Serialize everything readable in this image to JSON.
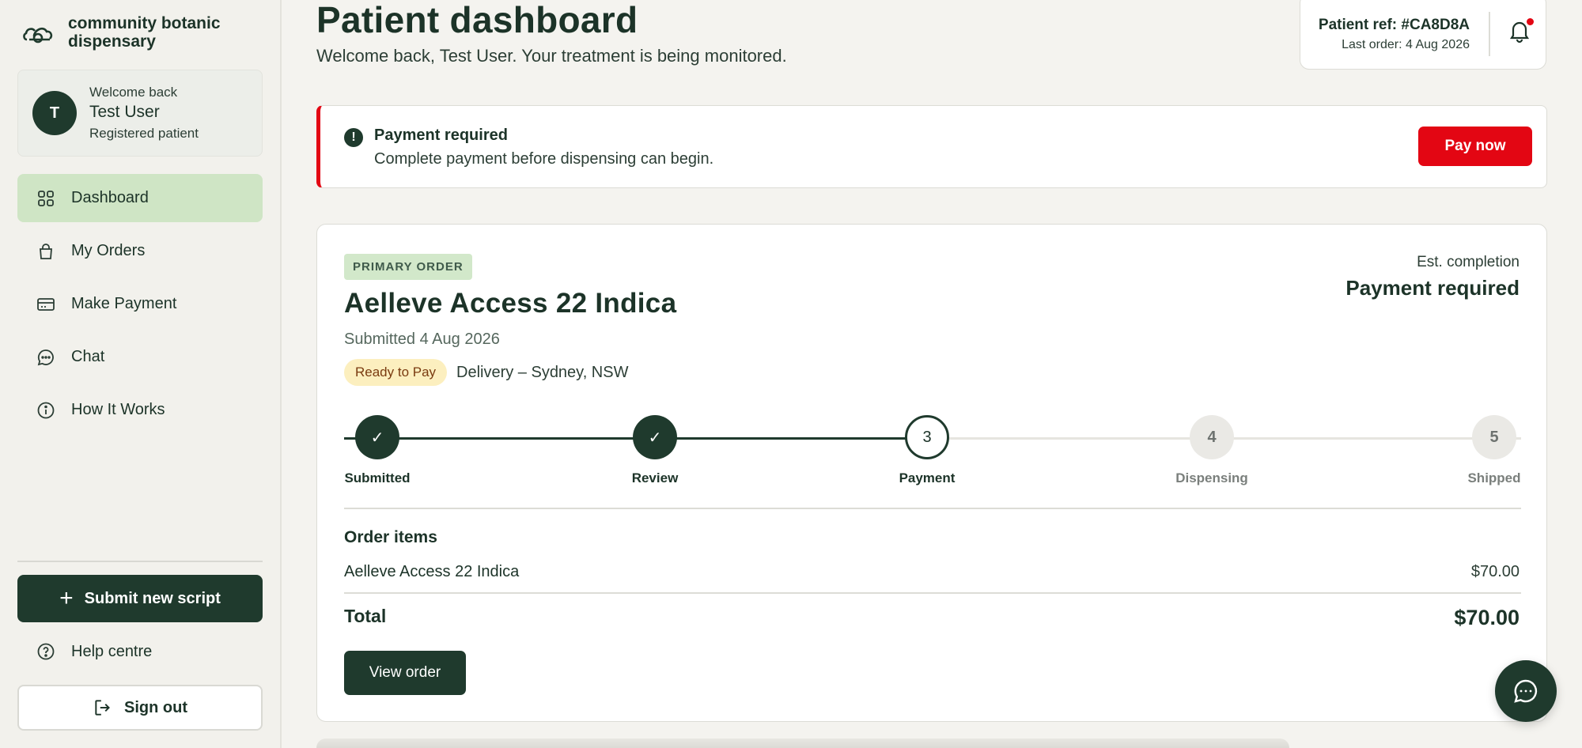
{
  "brand": {
    "name": "community botanic dispensary",
    "logo_icon": "cannabis-leaf-logo"
  },
  "user_card": {
    "avatar_initial": "T",
    "greeting": "Welcome back",
    "name": "Test User",
    "role": "Registered patient"
  },
  "sidebar": {
    "items": [
      {
        "label": "Dashboard",
        "icon": "grid-icon",
        "active": true
      },
      {
        "label": "My Orders",
        "icon": "bag-icon",
        "active": false
      },
      {
        "label": "Make Payment",
        "icon": "card-icon",
        "active": false
      },
      {
        "label": "Chat",
        "icon": "chat-bubble-icon",
        "active": false
      },
      {
        "label": "How It Works",
        "icon": "info-icon",
        "active": false
      }
    ],
    "submit_label": "Submit new script",
    "help_label": "Help centre",
    "signout_label": "Sign out"
  },
  "header": {
    "title": "Patient dashboard",
    "subtitle": "Welcome back, Test User. Your treatment is being monitored.",
    "patient_ref": "Patient ref: #CA8D8A",
    "last_order": "Last order: 4 Aug 2026",
    "notification_dot": true
  },
  "alert": {
    "title": "Payment required",
    "message": "Complete payment before dispensing can begin.",
    "button_label": "Pay now",
    "accent_color": "#e30613"
  },
  "order": {
    "badge": "PRIMARY ORDER",
    "name": "Aelleve Access 22 Indica",
    "submitted": "Submitted 4 Aug 2026",
    "status": "Ready to Pay",
    "delivery": "Delivery – Sydney, NSW",
    "est_label": "Est. completion",
    "est_value": "Payment required",
    "steps": [
      {
        "number": "1",
        "label": "Submitted",
        "state": "done"
      },
      {
        "number": "2",
        "label": "Review",
        "state": "done"
      },
      {
        "number": "3",
        "label": "Payment",
        "state": "current"
      },
      {
        "number": "4",
        "label": "Dispensing",
        "state": "todo"
      },
      {
        "number": "5",
        "label": "Shipped",
        "state": "todo"
      }
    ],
    "items_title": "Order items",
    "items": [
      {
        "name": "Aelleve Access 22 Indica",
        "price": "$70.00"
      }
    ],
    "total_label": "Total",
    "total_value": "$70.00",
    "view_label": "View order"
  },
  "colors": {
    "primary": "#1f3a2d",
    "active_nav": "#cfe5c5",
    "alert": "#e30613",
    "pill_bg": "#fcefbf"
  }
}
